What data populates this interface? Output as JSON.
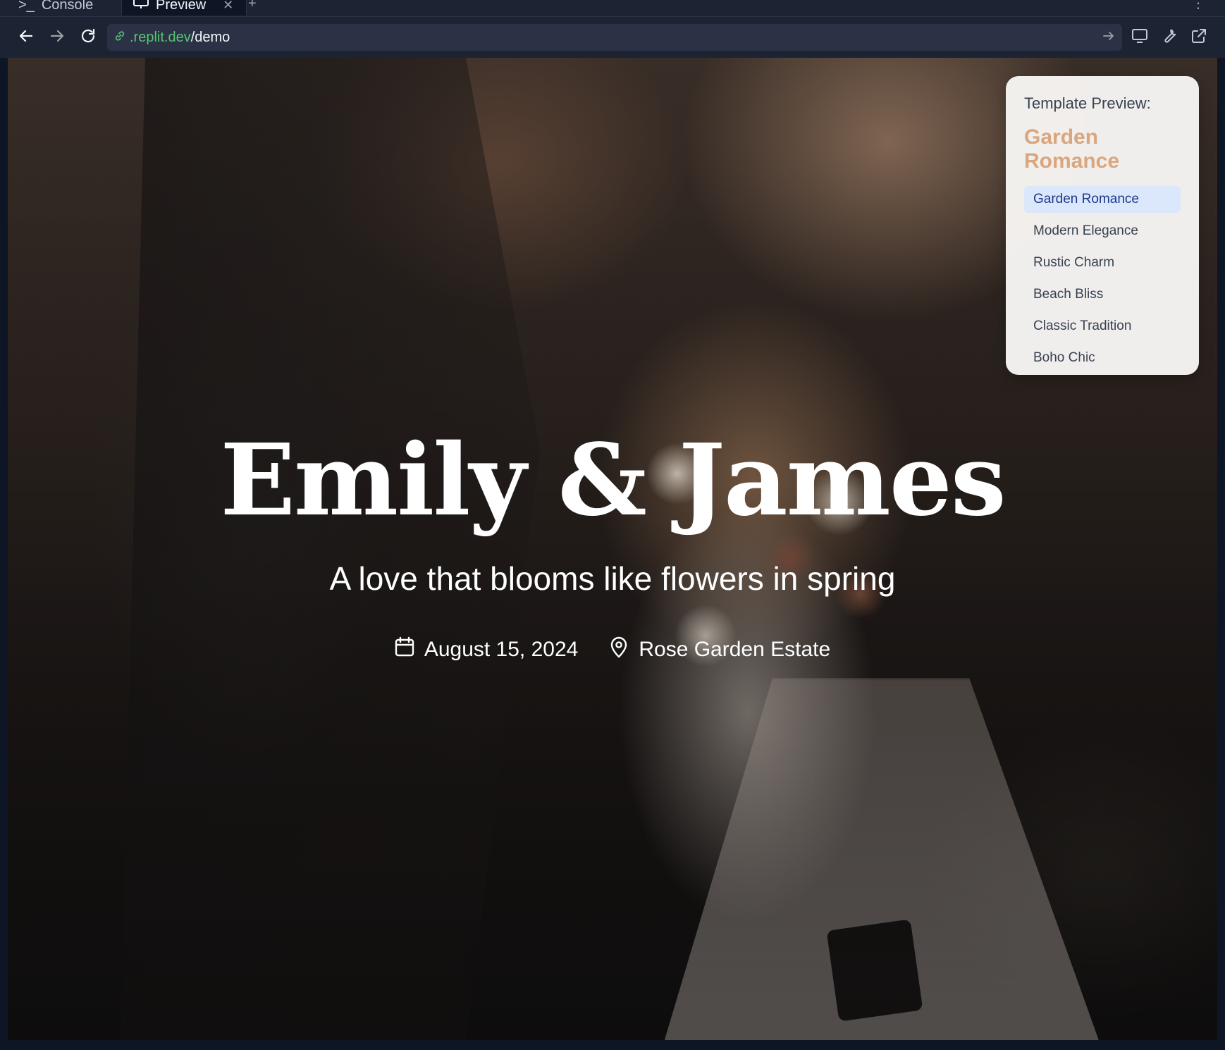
{
  "tabs": [
    {
      "label": "Console",
      "icon": "terminal-icon"
    },
    {
      "label": "Preview",
      "icon": "monitor-icon",
      "active": true
    }
  ],
  "url": {
    "host": ".replit.dev",
    "path": "/demo"
  },
  "hero": {
    "title": "Emily & James",
    "subtitle": "A love that blooms like flowers in spring",
    "date": "August 15, 2024",
    "venue": "Rose Garden Estate"
  },
  "template_panel": {
    "label": "Template Preview:",
    "current": "Garden Romance",
    "templates": [
      "Garden Romance",
      "Modern Elegance",
      "Rustic Charm",
      "Beach Bliss",
      "Classic Tradition",
      "Boho Chic"
    ],
    "accent_color": "#d9a67e",
    "active_bg": "#dbe7fb"
  }
}
